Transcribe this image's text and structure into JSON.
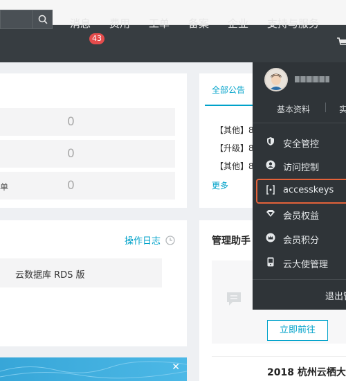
{
  "header": {
    "nav": [
      {
        "label": "消息"
      },
      {
        "label": "费用"
      },
      {
        "label": "工单"
      },
      {
        "label": "备案"
      },
      {
        "label": "企业"
      },
      {
        "label": "支持与服务"
      }
    ],
    "message_badge": "43"
  },
  "stats": {
    "rows": [
      {
        "label": "",
        "value": "0"
      },
      {
        "label": "",
        "value": "0"
      },
      {
        "label": "单",
        "value": "0"
      }
    ]
  },
  "activity": {
    "oplog_label": "操作日志",
    "rds_label": "云数据库 RDS 版"
  },
  "announcements": {
    "tab": "全部公告",
    "lines": [
      "【其他】8",
      "【升级】8",
      "【其他】8"
    ],
    "more": "更多"
  },
  "helper": {
    "title": "管理助手",
    "goto_button": "立即前往",
    "event_title": "2018 杭州云栖大"
  },
  "account_menu": {
    "tabs": [
      "基本资料",
      "实"
    ],
    "items": [
      {
        "label": "安全管控",
        "icon": "shield-icon"
      },
      {
        "label": "访问控制",
        "icon": "user-icon"
      },
      {
        "label": "accesskeys",
        "icon": "key-icon"
      },
      {
        "label": "会员权益",
        "icon": "diamond-icon"
      },
      {
        "label": "会员积分",
        "icon": "crown-icon"
      },
      {
        "label": "云大使管理",
        "icon": "phone-icon"
      }
    ],
    "logout": "退出管"
  },
  "colors": {
    "header_bg": "#373d41",
    "accent": "#00a2ca",
    "badge": "#e54c4c",
    "highlight": "#e4623a"
  }
}
